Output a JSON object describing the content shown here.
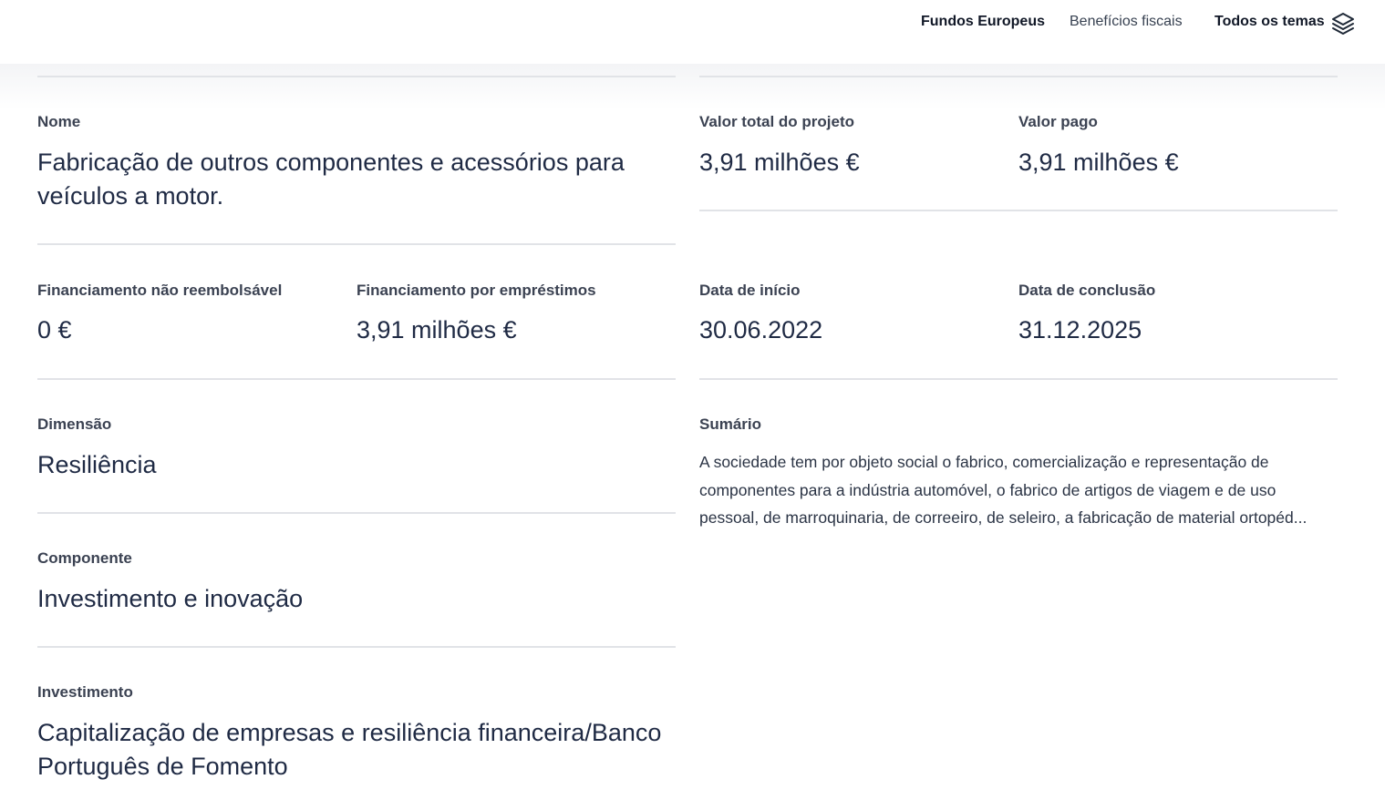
{
  "nav": {
    "fundos": "Fundos Europeus",
    "beneficios": "Benefícios fiscais",
    "todos": "Todos os temas",
    "icon": "layers-icon"
  },
  "fields": {
    "nome": {
      "label": "Nome",
      "value": "Fabricação de outros componentes e acessórios para veículos a motor."
    },
    "valor_total": {
      "label": "Valor total do projeto",
      "value": "3,91 milhões €"
    },
    "valor_pago": {
      "label": "Valor pago",
      "value": "3,91 milhões €"
    },
    "fin_nao_reemb": {
      "label": "Financiamento não reembolsável",
      "value": "0 €"
    },
    "fin_emprestimos": {
      "label": "Financiamento por empréstimos",
      "value": "3,91 milhões €"
    },
    "data_inicio": {
      "label": "Data de início",
      "value": "30.06.2022"
    },
    "data_conclusao": {
      "label": "Data de conclusão",
      "value": "31.12.2025"
    },
    "dimensao": {
      "label": "Dimensão",
      "value": "Resiliência"
    },
    "componente": {
      "label": "Componente",
      "value": "Investimento e inovação"
    },
    "investimento": {
      "label": "Investimento",
      "value": "Capitalização de empresas e resiliência financeira/Banco Português de Fomento"
    },
    "sumario": {
      "label": "Sumário",
      "value": "A sociedade tem por objeto social o fabrico, comercialização e representação de componentes para a indústria automóvel, o fabrico de artigos de viagem e de uso pessoal, de marroquinaria, de correeiro, de seleiro, a fabricação de material ortopéd..."
    }
  },
  "colors": {
    "text": "#1f2a44",
    "label": "#3b4252",
    "divider": "#e1e3e7"
  }
}
